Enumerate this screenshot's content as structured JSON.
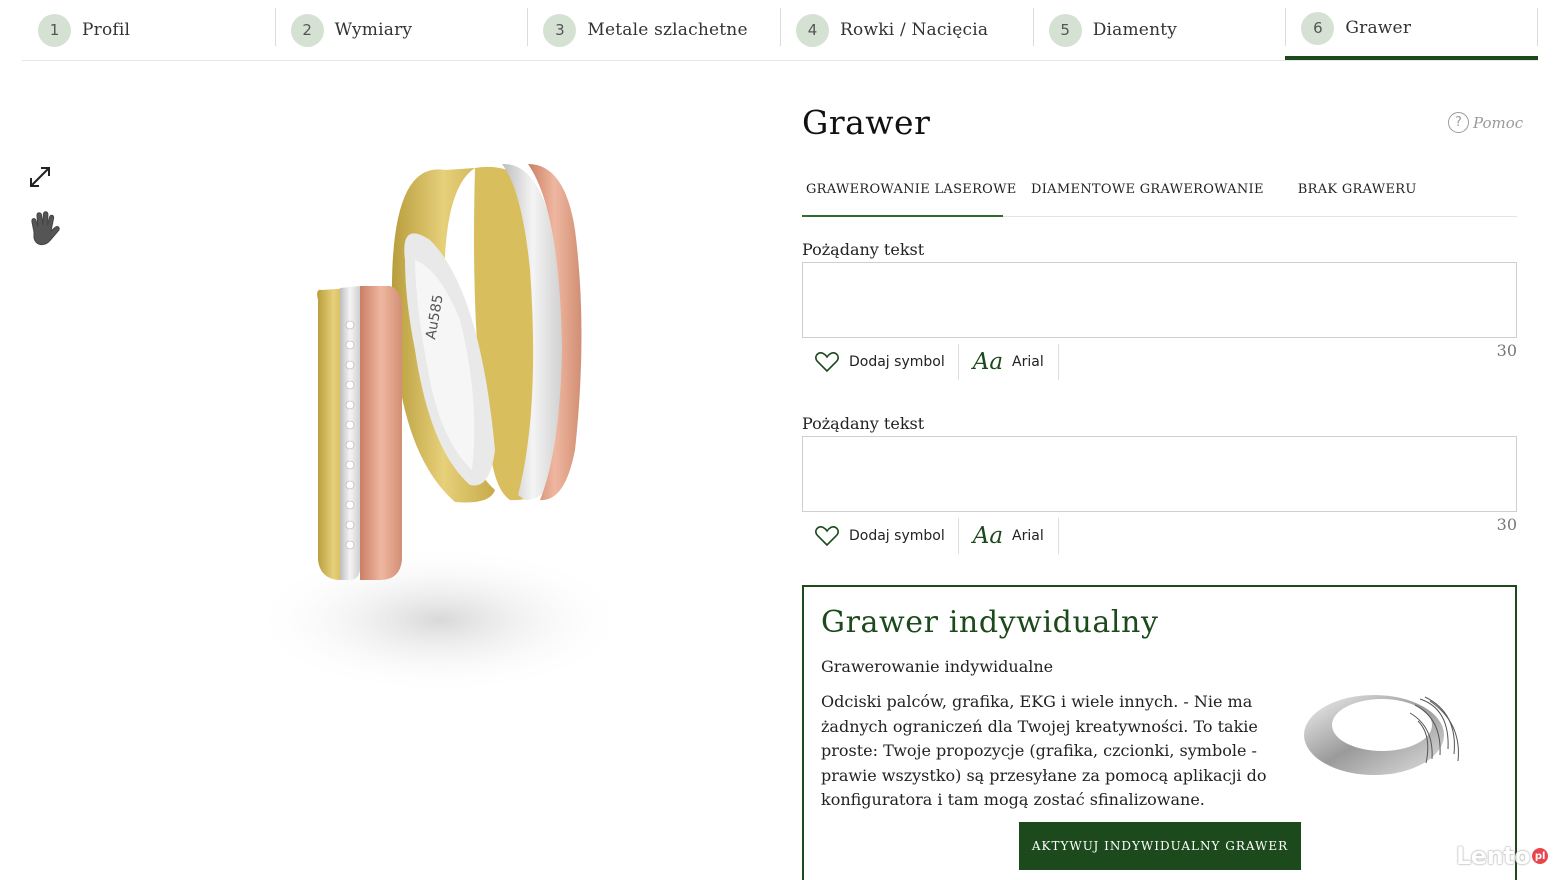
{
  "steps": [
    {
      "num": "1",
      "label": "Profil"
    },
    {
      "num": "2",
      "label": "Wymiary"
    },
    {
      "num": "3",
      "label": "Metale szlachetne"
    },
    {
      "num": "4",
      "label": "Rowki / Nacięcia"
    },
    {
      "num": "5",
      "label": "Diamenty"
    },
    {
      "num": "6",
      "label": "Grawer"
    }
  ],
  "active_step": "6",
  "tools": {
    "expand_icon": "expand-icon",
    "hand_icon": "hand-icon"
  },
  "product": {
    "ring_stamp": "Au585"
  },
  "panel": {
    "title": "Grawer",
    "help_label": "Pomoc",
    "tabs": [
      "GRAWEROWANIE LASEROWE",
      "DIAMENTOWE GRAWEROWANIE",
      "BRAK GRAWERU"
    ],
    "active_tab": "GRAWEROWANIE LASEROWE",
    "fields": [
      {
        "label": "Pożądany tekst",
        "value": "",
        "counter": "30",
        "symbol_label": "Dodaj symbol",
        "font_sample": "Aa",
        "font_name": "Arial"
      },
      {
        "label": "Pożądany tekst",
        "value": "",
        "counter": "30",
        "symbol_label": "Dodaj symbol",
        "font_sample": "Aa",
        "font_name": "Arial"
      }
    ]
  },
  "custom": {
    "title": "Grawer indywidualny",
    "subtitle": "Grawerowanie indywidualne",
    "description": "Odciski palców, grafika, EKG i wiele innych. - Nie ma żadnych ograniczeń dla Twojej kreatywności. To takie proste: Twoje propozycje (grafika, czcionki, symbole - prawie wszystko) są przesyłane za pomocą aplikacji do konfiguratora i tam mogą zostać sfinalizowane.",
    "button_label": "AKTYWUJ INDYWIDUALNY GRAWER"
  },
  "watermark": {
    "text": "Lento",
    "dot": "pl"
  },
  "colors": {
    "accent": "#1c4a1c",
    "step_circle": "#d5e2d3"
  }
}
